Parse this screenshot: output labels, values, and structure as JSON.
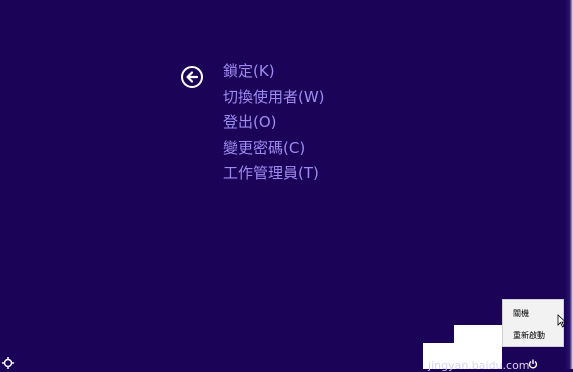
{
  "screen": {
    "background": "#1b0358",
    "accent_text": "#9d8cf0"
  },
  "back_button": {
    "icon": "arrow-left-circle-icon"
  },
  "menu": {
    "items": [
      {
        "label": "鎖定(K)"
      },
      {
        "label": "切換使用者(W)"
      },
      {
        "label": "登出(O)"
      },
      {
        "label": "變更密碼(C)"
      },
      {
        "label": "工作管理員(T)"
      }
    ]
  },
  "power_menu": {
    "items": [
      {
        "label": "關機"
      },
      {
        "label": "重新啟動"
      }
    ]
  },
  "watermark": {
    "text": "jingyan.baidu.com"
  },
  "bottom_icons": {
    "left": "ease-of-access-icon",
    "right": "power-icon"
  }
}
